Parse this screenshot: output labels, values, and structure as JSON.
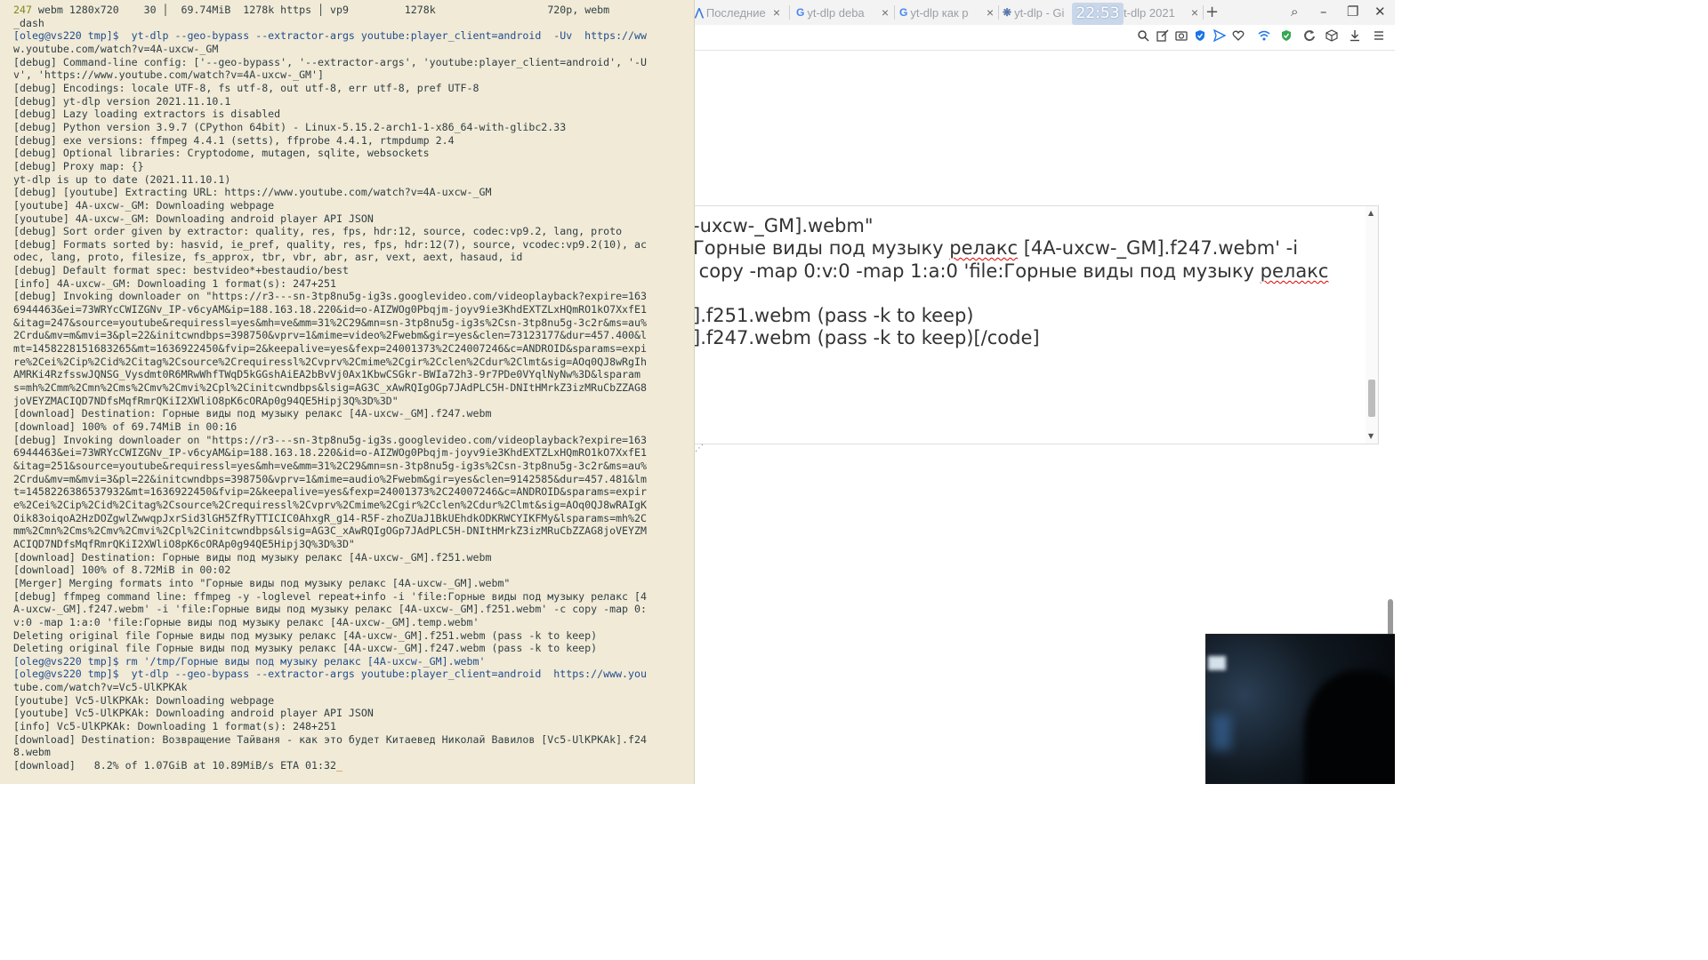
{
  "terminal": {
    "header": {
      "num": "247",
      "rest": " webm 1280x720    30 ",
      "sep1": "│",
      "mid": "  69.74MiB  1278k https ",
      "sep2": "│",
      "tail": " vp9         1278k                  720p, webm"
    },
    "lines": [
      {
        "text": "_dash",
        "type": "out"
      },
      {
        "text": "[oleg@vs220 tmp]$  yt-dlp --geo-bypass --extractor-args youtube:player_client=android  -Uv  https://ww",
        "type": "prompt"
      },
      {
        "text": "w.youtube.com/watch?v=4A-uxcw-_GM",
        "type": "out"
      },
      {
        "text": "[debug] Command-line config: ['--geo-bypass', '--extractor-args', 'youtube:player_client=android', '-U",
        "type": "out"
      },
      {
        "text": "v', 'https://www.youtube.com/watch?v=4A-uxcw-_GM']",
        "type": "out"
      },
      {
        "text": "[debug] Encodings: locale UTF-8, fs utf-8, out utf-8, err utf-8, pref UTF-8",
        "type": "out"
      },
      {
        "text": "[debug] yt-dlp version 2021.11.10.1",
        "type": "out"
      },
      {
        "text": "[debug] Lazy loading extractors is disabled",
        "type": "out"
      },
      {
        "text": "[debug] Python version 3.9.7 (CPython 64bit) - Linux-5.15.2-arch1-1-x86_64-with-glibc2.33",
        "type": "out"
      },
      {
        "text": "[debug] exe versions: ffmpeg 4.4.1 (setts), ffprobe 4.4.1, rtmpdump 2.4",
        "type": "out"
      },
      {
        "text": "[debug] Optional libraries: Cryptodome, mutagen, sqlite, websockets",
        "type": "out"
      },
      {
        "text": "[debug] Proxy map: {}",
        "type": "out"
      },
      {
        "text": "yt-dlp is up to date (2021.11.10.1)",
        "type": "out"
      },
      {
        "text": "[debug] [youtube] Extracting URL: https://www.youtube.com/watch?v=4A-uxcw-_GM",
        "type": "out"
      },
      {
        "text": "[youtube] 4A-uxcw-_GM: Downloading webpage",
        "type": "out"
      },
      {
        "text": "[youtube] 4A-uxcw-_GM: Downloading android player API JSON",
        "type": "out"
      },
      {
        "text": "[debug] Sort order given by extractor: quality, res, fps, hdr:12, source, codec:vp9.2, lang, proto",
        "type": "out"
      },
      {
        "text": "[debug] Formats sorted by: hasvid, ie_pref, quality, res, fps, hdr:12(7), source, vcodec:vp9.2(10), ac",
        "type": "out"
      },
      {
        "text": "odec, lang, proto, filesize, fs_approx, tbr, vbr, abr, asr, vext, aext, hasaud, id",
        "type": "out"
      },
      {
        "text": "[debug] Default format spec: bestvideo*+bestaudio/best",
        "type": "out"
      },
      {
        "text": "[info] 4A-uxcw-_GM: Downloading 1 format(s): 247+251",
        "type": "out"
      },
      {
        "text": "[debug] Invoking downloader on \"https://r3---sn-3tp8nu5g-ig3s.googlevideo.com/videoplayback?expire=163",
        "type": "out"
      },
      {
        "text": "6944463&ei=73WRYcCWIZGNv_IP-v6cyAM&ip=188.163.18.220&id=o-AIZWOg0Pbqjm-joyv9ie3KhdEXTZLxHQmRO1kO7XxfE1",
        "type": "out"
      },
      {
        "text": "&itag=247&source=youtube&requiressl=yes&mh=ve&mm=31%2C29&mn=sn-3tp8nu5g-ig3s%2Csn-3tp8nu5g-3c2r&ms=au%",
        "type": "out"
      },
      {
        "text": "2Crdu&mv=m&mvi=3&pl=22&initcwndbps=398750&vprv=1&mime=video%2Fwebm&gir=yes&clen=73123177&dur=457.400&l",
        "type": "out"
      },
      {
        "text": "mt=1458228151683265&mt=1636922450&fvip=2&keepalive=yes&fexp=24001373%2C24007246&c=ANDROID&sparams=expi",
        "type": "out"
      },
      {
        "text": "re%2Cei%2Cip%2Cid%2Citag%2Csource%2Crequiressl%2Cvprv%2Cmime%2Cgir%2Cclen%2Cdur%2Clmt&sig=AOq0QJ8wRgIh",
        "type": "out"
      },
      {
        "text": "AMRKi4RzfsswJQNSG_Vysdmt0R6MRwWhfTWqD5kGGshAiEA2bBvVj0Ax1KbwCSGkr-BWIa72h3-9r7PDe0VYqlNyNw%3D&lsparam",
        "type": "out"
      },
      {
        "text": "s=mh%2Cmm%2Cmn%2Cms%2Cmv%2Cmvi%2Cpl%2Cinitcwndbps&lsig=AG3C_xAwRQIgOGp7JAdPLC5H-DNItHMrkZ3izMRuCbZZAG8",
        "type": "out"
      },
      {
        "text": "joVEYZMACIQD7NDfsMqfRmrQKiI2XWliO8pK6cORAp0g94QE5Hipj3Q%3D%3D\"",
        "type": "out"
      },
      {
        "text": "[download] Destination: Горные виды под музыку релакс [4A-uxcw-_GM].f247.webm",
        "type": "out"
      },
      {
        "text": "[download] 100% of 69.74MiB in 00:16",
        "type": "out"
      },
      {
        "text": "[debug] Invoking downloader on \"https://r3---sn-3tp8nu5g-ig3s.googlevideo.com/videoplayback?expire=163",
        "type": "out"
      },
      {
        "text": "6944463&ei=73WRYcCWIZGNv_IP-v6cyAM&ip=188.163.18.220&id=o-AIZWOg0Pbqjm-joyv9ie3KhdEXTZLxHQmRO1kO7XxfE1",
        "type": "out"
      },
      {
        "text": "&itag=251&source=youtube&requiressl=yes&mh=ve&mm=31%2C29&mn=sn-3tp8nu5g-ig3s%2Csn-3tp8nu5g-3c2r&ms=au%",
        "type": "out"
      },
      {
        "text": "2Crdu&mv=m&mvi=3&pl=22&initcwndbps=398750&vprv=1&mime=audio%2Fwebm&gir=yes&clen=9142585&dur=457.481&lm",
        "type": "out"
      },
      {
        "text": "t=1458226386537932&mt=1636922450&fvip=2&keepalive=yes&fexp=24001373%2C24007246&c=ANDROID&sparams=expir",
        "type": "out"
      },
      {
        "text": "e%2Cei%2Cip%2Cid%2Citag%2Csource%2Crequiressl%2Cvprv%2Cmime%2Cgir%2Cclen%2Cdur%2Clmt&sig=AOq0QJ8wRAIgK",
        "type": "out"
      },
      {
        "text": "Oik83oiqoA2HzDOZgwlZwwqpJxrSid3lGH5ZfRyTTICIC0AhxgR_g14-R5F-zhoZUaJ1BkUEhdkODKRWCYIKFMy&lsparams=mh%2C",
        "type": "out"
      },
      {
        "text": "mm%2Cmn%2Cms%2Cmv%2Cmvi%2Cpl%2Cinitcwndbps&lsig=AG3C_xAwRQIgOGp7JAdPLC5H-DNItHMrkZ3izMRuCbZZAG8joVEYZM",
        "type": "out"
      },
      {
        "text": "ACIQD7NDfsMqfRmrQKiI2XWliO8pK6cORAp0g94QE5Hipj3Q%3D%3D\"",
        "type": "out"
      },
      {
        "text": "[download] Destination: Горные виды под музыку релакс [4A-uxcw-_GM].f251.webm",
        "type": "out"
      },
      {
        "text": "[download] 100% of 8.72MiB in 00:02",
        "type": "out"
      },
      {
        "text": "[Merger] Merging formats into \"Горные виды под музыку релакс [4A-uxcw-_GM].webm\"",
        "type": "out"
      },
      {
        "text": "[debug] ffmpeg command line: ffmpeg -y -loglevel repeat+info -i 'file:Горные виды под музыку релакс [4",
        "type": "out"
      },
      {
        "text": "A-uxcw-_GM].f247.webm' -i 'file:Горные виды под музыку релакс [4A-uxcw-_GM].f251.webm' -c copy -map 0:",
        "type": "out"
      },
      {
        "text": "v:0 -map 1:a:0 'file:Горные виды под музыку релакс [4A-uxcw-_GM].temp.webm'",
        "type": "out"
      },
      {
        "text": "Deleting original file Горные виды под музыку релакс [4A-uxcw-_GM].f251.webm (pass -k to keep)",
        "type": "out"
      },
      {
        "text": "Deleting original file Горные виды под музыку релакс [4A-uxcw-_GM].f247.webm (pass -k to keep)",
        "type": "out"
      },
      {
        "text": "[oleg@vs220 tmp]$ rm '/tmp/Горные виды под музыку релакс [4A-uxcw-_GM].webm'",
        "type": "prompt"
      },
      {
        "text": "[oleg@vs220 tmp]$  yt-dlp --geo-bypass --extractor-args youtube:player_client=android  https://www.you",
        "type": "prompt"
      },
      {
        "text": "tube.com/watch?v=Vc5-UlKPKAk",
        "type": "out"
      },
      {
        "text": "[youtube] Vc5-UlKPKAk: Downloading webpage",
        "type": "out"
      },
      {
        "text": "[youtube] Vc5-UlKPKAk: Downloading android player API JSON",
        "type": "out"
      },
      {
        "text": "[info] Vc5-UlKPKAk: Downloading 1 format(s): 248+251",
        "type": "out"
      },
      {
        "text": "[download] Destination: Возвращение Тайваня - как это будет Китаевед Николай Вавилов [Vc5-UlKPKAk].f24",
        "type": "out"
      },
      {
        "text": "8.webm",
        "type": "out"
      },
      {
        "text": "[download]   8.2% of 1.07GiB at 10.89MiB/s ETA 01:32",
        "type": "out"
      }
    ],
    "cursor": "_"
  },
  "browser": {
    "tabs": [
      {
        "favicon": "",
        "label": "Последние",
        "close": "×"
      },
      {
        "favicon": "G",
        "label": "yt-dlp deba",
        "close": "×"
      },
      {
        "favicon": "G",
        "label": "yt-dlp как р",
        "close": "×"
      },
      {
        "favicon": "❋",
        "label": "yt-dlp - Gi",
        "close": ""
      },
      {
        "favicon": "",
        "label": "t-dlp 2021",
        "close": "×"
      }
    ],
    "new_tab": "+",
    "clock": "22:53",
    "window_controls": {
      "search": "⌕",
      "minimize": "–",
      "restore": "❐",
      "close": "✕"
    },
    "toolbar_icons": [
      "zoom-icon",
      "edit-icon",
      "camera-icon",
      "shield-icon",
      "send-icon",
      "heart-icon",
      "vpn-icon",
      "adblock-icon",
      "reload-icon",
      "cube-icon",
      "download-icon",
      "menu-icon"
    ],
    "editor": {
      "line1": "-uxcw-_GM].webm\"",
      "line2_a": "Горные виды под музыку ",
      "line2_spell": "релакс",
      "line2_b": " [4A-uxcw-_GM].f247.webm' -i",
      "line3_a": " copy -map 0:v:0 -map 1:a:0 'file:Горные виды под музыку ",
      "line3_spell": "релакс",
      "line4": "].f251.webm (pass -k to keep)",
      "line5": "].f247.webm (pass -k to keep)[/code]"
    }
  },
  "colors": {
    "terminal_bg": "#f1ead6",
    "terminal_fg": "#2f3f45",
    "prompt": "#1f4d8f",
    "cursor": "#d65a00"
  }
}
